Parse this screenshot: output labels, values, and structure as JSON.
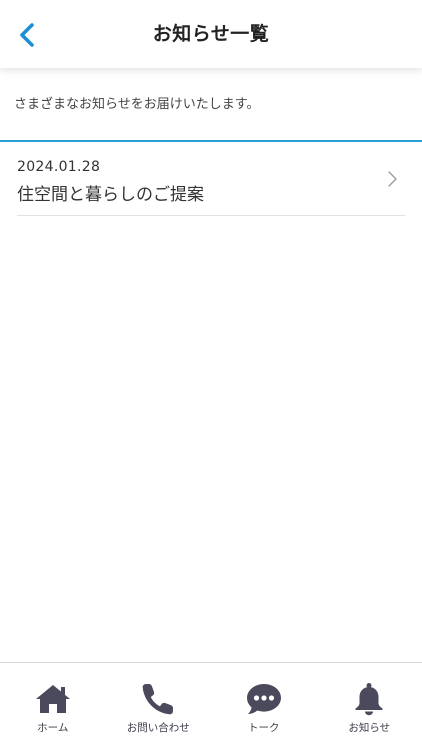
{
  "header": {
    "title": "お知らせ一覧",
    "back_icon": "chevron-left-icon",
    "accent_color": "#1e8fd3"
  },
  "intro": {
    "text": "さまざまなお知らせをお届けいたします。"
  },
  "news": [
    {
      "date": "2024.01.28",
      "title": "住空間と暮らしのご提案"
    }
  ],
  "bottom_nav": {
    "icon_color": "#4a4a5c",
    "items": [
      {
        "label": "ホーム",
        "icon": "home-icon"
      },
      {
        "label": "お問い合わせ",
        "icon": "phone-icon"
      },
      {
        "label": "トーク",
        "icon": "chat-bubble-icon"
      },
      {
        "label": "お知らせ",
        "icon": "bell-icon"
      }
    ]
  }
}
